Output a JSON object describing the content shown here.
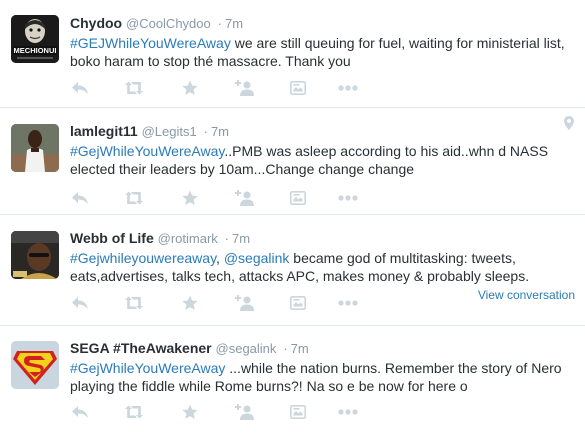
{
  "tweets": [
    {
      "fullname": "Chydoo",
      "username": "@CoolChydoo",
      "dot": "·",
      "time": "7m",
      "segments": [
        {
          "t": "#GEJWhileYouWereAway",
          "k": "tag"
        },
        {
          "t": " we are still queuing for fuel, waiting for ministerial list, boko haram to stop thé massacre. Thank you",
          "k": "text"
        }
      ],
      "avatar_label": "MECHIONUI"
    },
    {
      "fullname": "lamlegit11",
      "username": "@Legits1",
      "dot": "·",
      "time": "7m",
      "segments": [
        {
          "t": "#GejWhileYouWereAway",
          "k": "tag"
        },
        {
          "t": "..PMB was asleep according to his aid..whn d NASS elected their leaders by 10am...Change change change",
          "k": "text"
        }
      ]
    },
    {
      "fullname": "Webb of Life",
      "username": "@rotimark",
      "dot": "·",
      "time": "7m",
      "segments": [
        {
          "t": "#Gejwhileyouwereaway",
          "k": "tag"
        },
        {
          "t": ", ",
          "k": "text"
        },
        {
          "t": "@segalink",
          "k": "mention"
        },
        {
          "t": " became god of multitasking: tweets, eats,advertises, talks tech, attacks APC, makes money & probably sleeps.",
          "k": "text"
        }
      ],
      "convo": "View conversation"
    },
    {
      "fullname": "SEGA #TheAwakener",
      "username": "@segalink",
      "dot": "·",
      "time": "7m",
      "segments": [
        {
          "t": "#GejWhileYouWereAway",
          "k": "tag"
        },
        {
          "t": " ...while the nation burns. Remember the story of Nero playing the fiddle while Rome burns?! Na so e be now for here o",
          "k": "text"
        }
      ]
    }
  ],
  "icons": {
    "reply": "reply-icon",
    "retweet": "retweet-icon",
    "favorite": "star-icon",
    "follow": "follow-icon",
    "summary": "summary-icon",
    "more": "more-icon",
    "geo": "location-pin-icon"
  },
  "colors": {
    "link": "#2b7bb9",
    "muted": "#8899a6",
    "icon": "#ccd6dd",
    "border": "#e1e8ed",
    "text": "#292f33"
  }
}
